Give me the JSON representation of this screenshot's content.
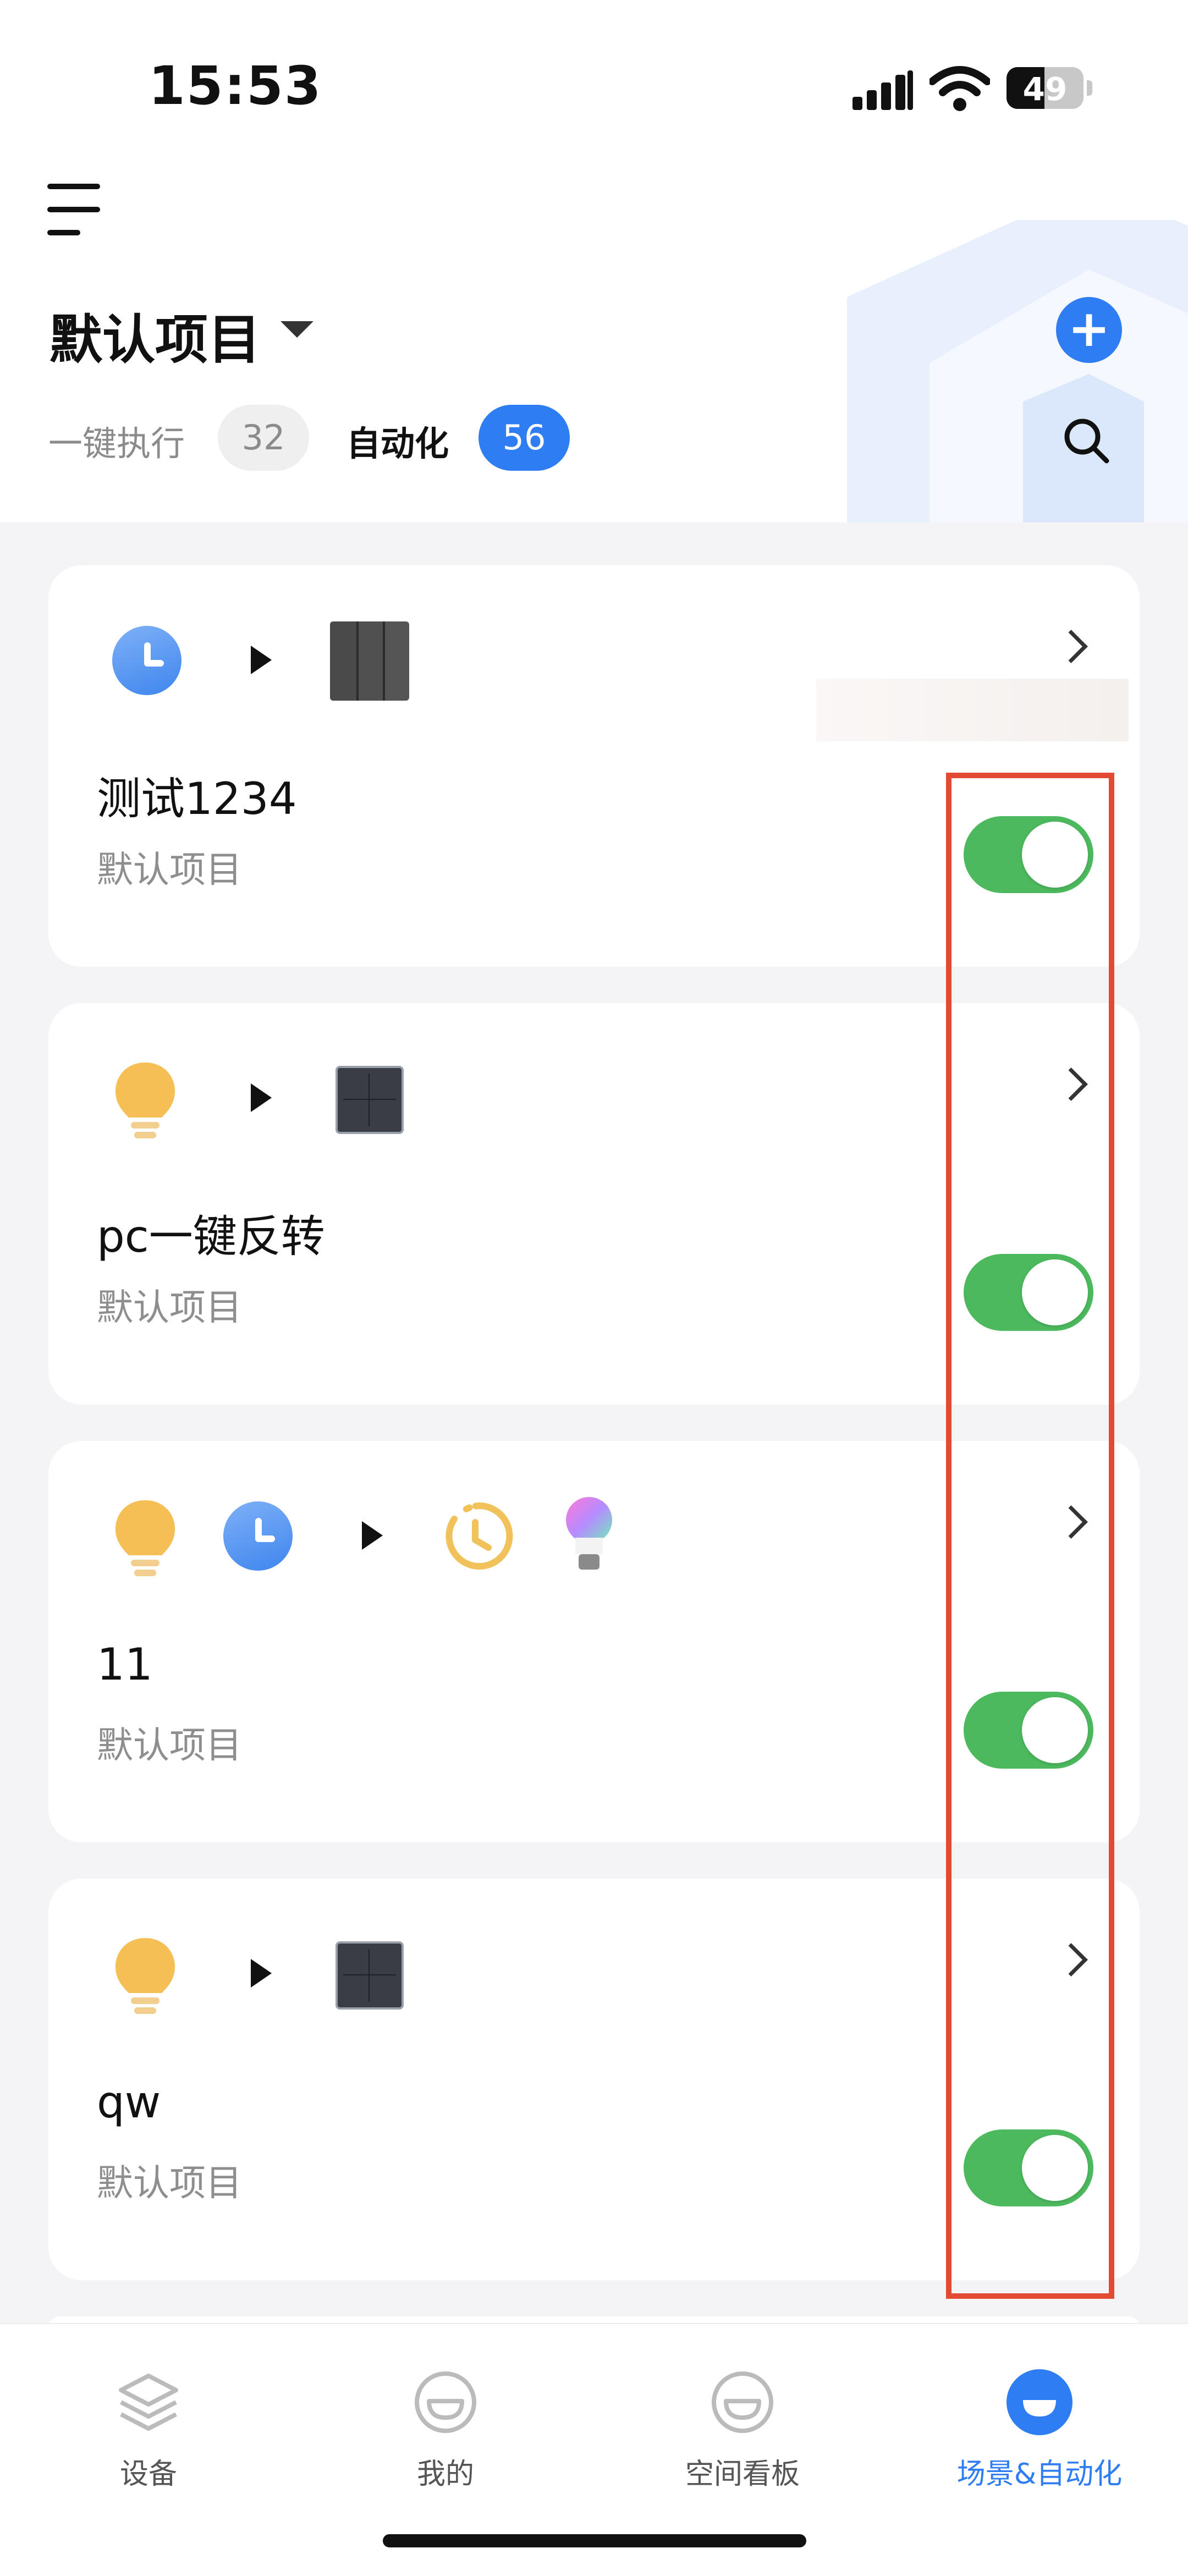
{
  "status_bar": {
    "time": "15:53",
    "battery": "49"
  },
  "header": {
    "project_title": "默认项目",
    "tabs": [
      {
        "label": "一键执行",
        "count": "32"
      },
      {
        "label": "自动化",
        "count": "56"
      }
    ]
  },
  "cards": [
    {
      "title": "测试1234",
      "subtitle": "默认项目"
    },
    {
      "title": "pc一键反转",
      "subtitle": "默认项目"
    },
    {
      "title": "11",
      "subtitle": "默认项目"
    },
    {
      "title": "qw",
      "subtitle": "默认项目"
    }
  ],
  "bottom_nav": [
    {
      "label": "设备",
      "icon": "layers-icon"
    },
    {
      "label": "我的",
      "icon": "smile-icon"
    },
    {
      "label": "空间看板",
      "icon": "smile-icon"
    },
    {
      "label": "场景&自动化",
      "icon": "scene-icon"
    }
  ],
  "colors": {
    "accent": "#2f7df3",
    "toggle_on": "#4cb95e",
    "highlight": "#e24a34"
  }
}
